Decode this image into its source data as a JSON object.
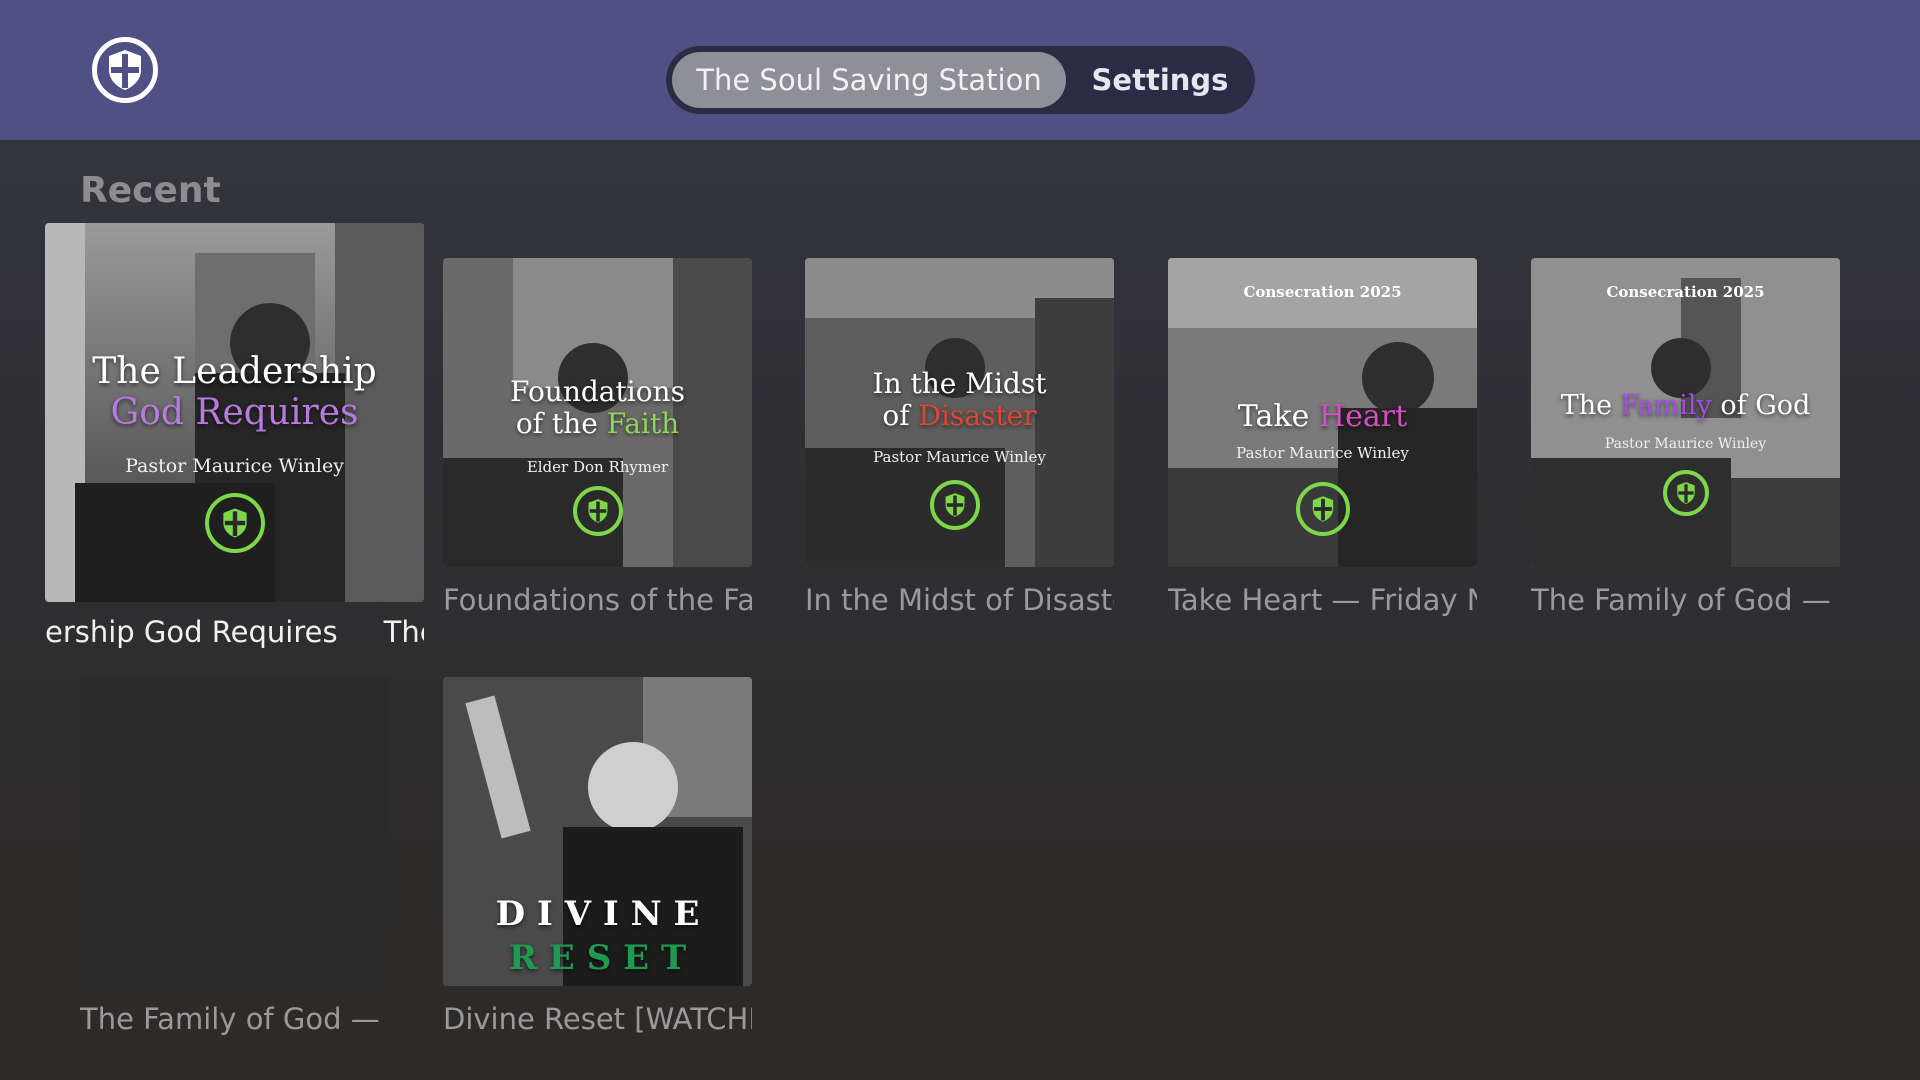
{
  "app": {
    "logo_icon": "shield-cross-icon"
  },
  "tabs": [
    {
      "label": "The Soul Saving Station",
      "active": true
    },
    {
      "label": "Settings",
      "active": false
    }
  ],
  "section": {
    "title": "Recent"
  },
  "cards": [
    {
      "label": "ership God Requires     The",
      "focused": true,
      "art": {
        "line1": "The Leadership",
        "line2": "God Requires",
        "line2_color": "#b77be0",
        "speaker": "Pastor Maurice Winley",
        "banner": ""
      }
    },
    {
      "label": "Foundations of the Fai",
      "art": {
        "line1": "Foundations",
        "line2a": "of the ",
        "line2b": "Faith",
        "line2_color": "#8fd65a",
        "speaker": "Elder Don Rhymer",
        "banner": ""
      }
    },
    {
      "label": "In the Midst of Disaste",
      "art": {
        "line1": "In the Midst",
        "line2a": "of ",
        "line2b": "Disaster",
        "line2_color": "#e0452e",
        "speaker": "Pastor Maurice Winley",
        "banner": ""
      }
    },
    {
      "label": "Take Heart — Friday Ni",
      "art": {
        "line1a": "Take ",
        "line1b": "Heart",
        "line1_color": "#d44fc0",
        "speaker": "Pastor Maurice Winley",
        "banner": "Consecration 2025"
      }
    },
    {
      "label": "The Family of God — F",
      "art": {
        "line1a": "The ",
        "line1b": "Family",
        "line1c": " of God",
        "line1_color": "#a24fe0",
        "speaker": "Pastor Maurice Winley",
        "banner": "Consecration 2025"
      }
    },
    {
      "label": "The Family of God — F",
      "art": {}
    },
    {
      "label": "Divine Reset [WATCHI",
      "art": {
        "line1": "D I V I N E",
        "line2": "R E S E T",
        "line2_color": "#1f9a52"
      }
    }
  ],
  "colors": {
    "topbar": "#4f5084",
    "accent_green": "#7ed64a"
  }
}
